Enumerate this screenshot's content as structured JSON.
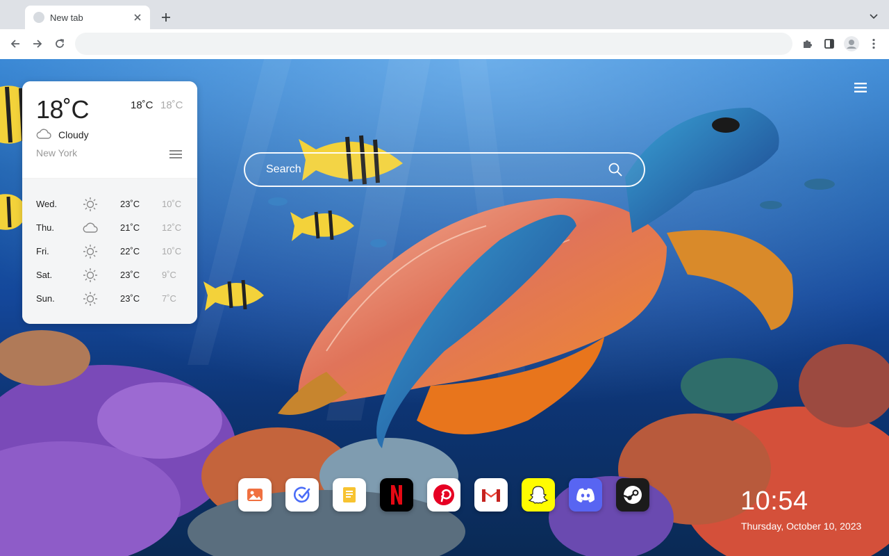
{
  "browser": {
    "tab_title": "New tab",
    "omnibox_placeholder": "",
    "icons": [
      "tab-favicon",
      "close-icon",
      "plus-icon",
      "chevron-down-icon",
      "back-arrow-icon",
      "forward-arrow-icon",
      "reload-icon",
      "puzzle-icon",
      "sidepanel-icon",
      "profile-icon",
      "kebab-menu-icon"
    ]
  },
  "weather": {
    "current_temp": "18˚C",
    "high": "18˚C",
    "low": "18˚C",
    "condition": "Cloudy",
    "condition_icon": "cloud-icon",
    "city": "New York",
    "forecast": [
      {
        "day": "Wed.",
        "icon": "sun-icon",
        "high": "23˚C",
        "low": "10˚C"
      },
      {
        "day": "Thu.",
        "icon": "cloud-icon",
        "high": "21˚C",
        "low": "12˚C"
      },
      {
        "day": "Fri.",
        "icon": "sun-icon",
        "high": "22˚C",
        "low": "10˚C"
      },
      {
        "day": "Sat.",
        "icon": "sun-icon",
        "high": "23˚C",
        "low": "9˚C"
      },
      {
        "day": "Sun.",
        "icon": "sun-icon",
        "high": "23˚C",
        "low": "7˚C"
      }
    ]
  },
  "search": {
    "placeholder": "Search"
  },
  "apps": [
    {
      "name": "Photos",
      "icon": "photos-icon",
      "bg": "#ffffff"
    },
    {
      "name": "Tasks",
      "icon": "tasks-icon",
      "bg": "#ffffff"
    },
    {
      "name": "Notes",
      "icon": "notes-icon",
      "bg": "#ffffff"
    },
    {
      "name": "Netflix",
      "icon": "netflix-icon",
      "bg": "#000000"
    },
    {
      "name": "Pinterest",
      "icon": "pinterest-icon",
      "bg": "#ffffff"
    },
    {
      "name": "Gmail",
      "icon": "gmail-icon",
      "bg": "#ffffff"
    },
    {
      "name": "Snapchat",
      "icon": "snapchat-icon",
      "bg": "#fffc00"
    },
    {
      "name": "Discord",
      "icon": "discord-icon",
      "bg": "#5865f2"
    },
    {
      "name": "Steam",
      "icon": "steam-icon",
      "bg": "#1b1b1b"
    }
  ],
  "clock": {
    "time": "10:54",
    "date": "Thursday, October 10, 2023"
  },
  "colors": {
    "accent_red": "#e50914",
    "pinterest": "#e60023",
    "discord": "#5865f2",
    "snapchat": "#fffc00"
  }
}
